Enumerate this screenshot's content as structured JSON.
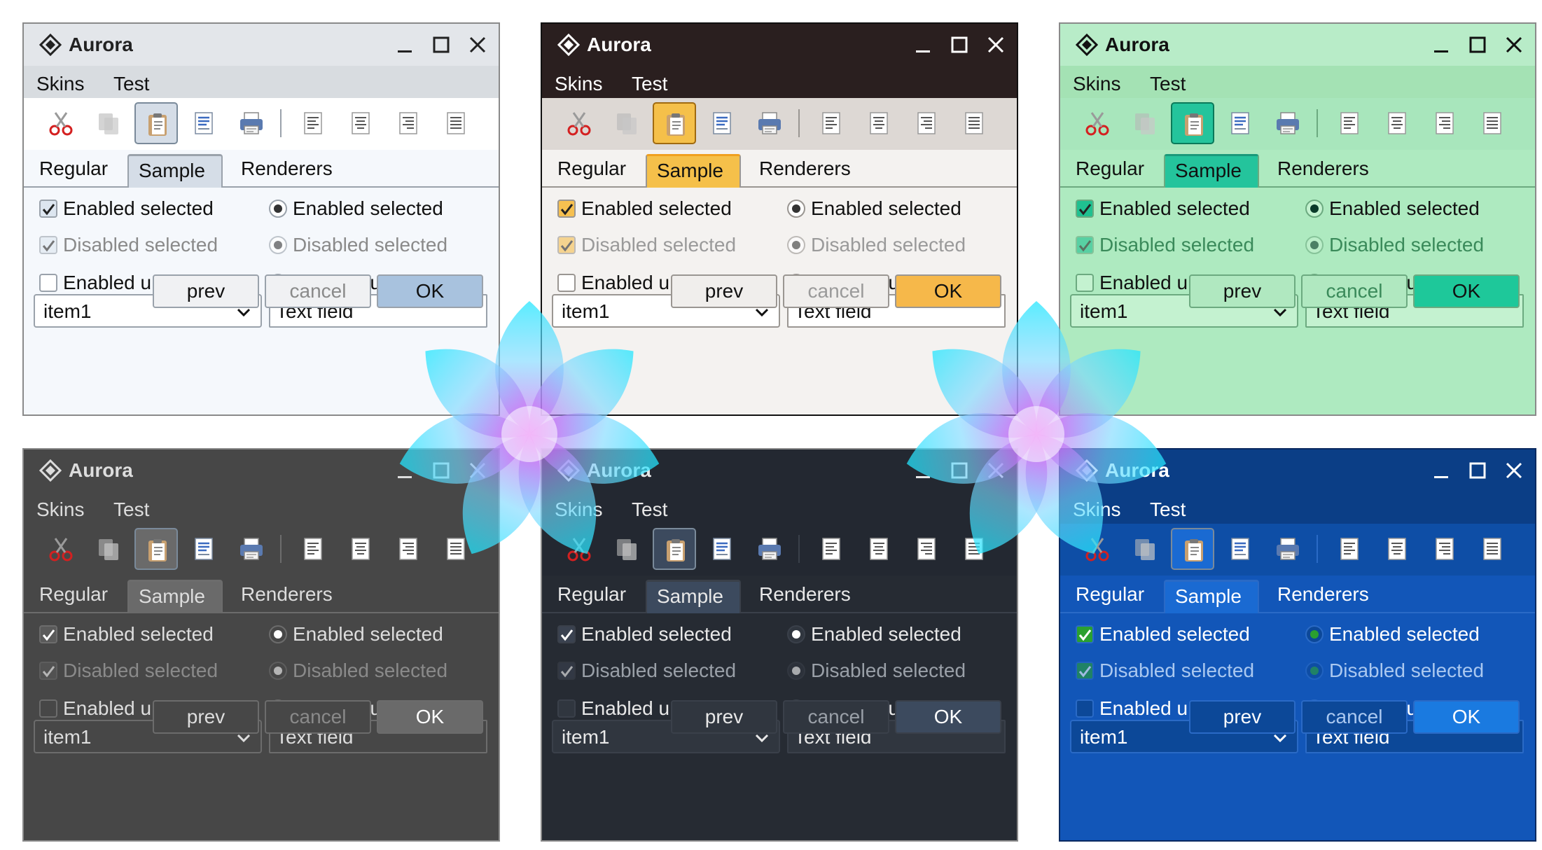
{
  "app": {
    "title": "Aurora",
    "menu": [
      "Skins",
      "Test"
    ],
    "tabs": [
      "Regular",
      "Sample",
      "Renderers"
    ],
    "selected_tab": "Sample",
    "rows": [
      {
        "left": "Enabled selected",
        "right": "Enabled selected"
      },
      {
        "left": "Disabled selected",
        "right": "Disabled selected"
      },
      {
        "left": "Enabled unselected",
        "right": "Enabled unselected"
      }
    ],
    "combo_value": "item1",
    "text_field_value": "Text field",
    "buttons": {
      "prev": "prev",
      "cancel": "cancel",
      "ok": "OK"
    },
    "toolbar_icons": [
      "scissors-icon",
      "copy-icon",
      "paste-icon",
      "document-icon",
      "printer-icon",
      "align-left-icon",
      "align-center-icon",
      "align-right-icon",
      "align-justify-icon"
    ]
  },
  "windows": [
    {
      "skin": "light-gray",
      "title_bg": "#e3e6ea",
      "title_fg": "#222222",
      "menu_bg": "#d8dce0",
      "menu_fg": "#111111",
      "toolbar_bg": "#ffffff",
      "accent": "#d5dde7",
      "content_bg": "#f5f8fc",
      "fg": "#111111",
      "dis_fg": "#8a8a8a",
      "field_bg": "#ffffff",
      "border": "#9aa2ab",
      "btn_bg": "#f0f1f3",
      "ok_bg": "#a8c2de"
    },
    {
      "skin": "black-title",
      "title_bg": "#2a1f1f",
      "title_fg": "#ffffff",
      "menu_bg": "#2a1f1f",
      "menu_fg": "#ffffff",
      "toolbar_bg": "#ddd8d4",
      "accent": "#f5c04a",
      "content_bg": "#f4f2f0",
      "fg": "#111111",
      "dis_fg": "#9a9a9a",
      "field_bg": "#ffffff",
      "border": "#9a9692",
      "btn_bg": "#f0eeec",
      "ok_bg": "#f6b84a"
    },
    {
      "skin": "mint",
      "title_bg": "#b8ecc8",
      "title_fg": "#111111",
      "menu_bg": "#a4e2b4",
      "menu_fg": "#111111",
      "toolbar_bg": "#a8e6bc",
      "accent": "#24c49c",
      "content_bg": "#aeeac0",
      "fg": "#111111",
      "dis_fg": "#3a8a5a",
      "field_bg": "#c4f2d0",
      "border": "#6caa80",
      "btn_bg": "#b0e8c0",
      "ok_bg": "#1ec89a"
    },
    {
      "skin": "graphite",
      "title_bg": "#474747",
      "title_fg": "#dddddd",
      "menu_bg": "#474747",
      "menu_fg": "#dddddd",
      "toolbar_bg": "#474747",
      "accent": "#6a6a6a",
      "content_bg": "#474747",
      "fg": "#dddddd",
      "dis_fg": "#8a8a8a",
      "field_bg": "#474747",
      "border": "#6c6c6c",
      "btn_bg": "#474747",
      "ok_bg": "#6a6a6a"
    },
    {
      "skin": "night",
      "title_bg": "#232831",
      "title_fg": "#e8e8e8",
      "menu_bg": "#232831",
      "menu_fg": "#e8e8e8",
      "toolbar_bg": "#232831",
      "accent": "#3c4a5e",
      "content_bg": "#262b33",
      "fg": "#e8e8e8",
      "dis_fg": "#9aa0a8",
      "field_bg": "#30363f",
      "border": "#3a404a",
      "btn_bg": "#30363f",
      "ok_bg": "#3c4a5e"
    },
    {
      "skin": "ocean",
      "title_bg": "#0b3e86",
      "title_fg": "#ffffff",
      "menu_bg": "#0b3e86",
      "menu_fg": "#ffffff",
      "toolbar_bg": "#0e4ea6",
      "accent": "#1a6ad2",
      "content_bg": "#1256b8",
      "fg": "#ffffff",
      "dis_fg": "#aac8f0",
      "field_bg": "#0c4898",
      "border": "#2a6ac6",
      "btn_bg": "#0c4898",
      "ok_bg": "#1a7ae0"
    }
  ]
}
